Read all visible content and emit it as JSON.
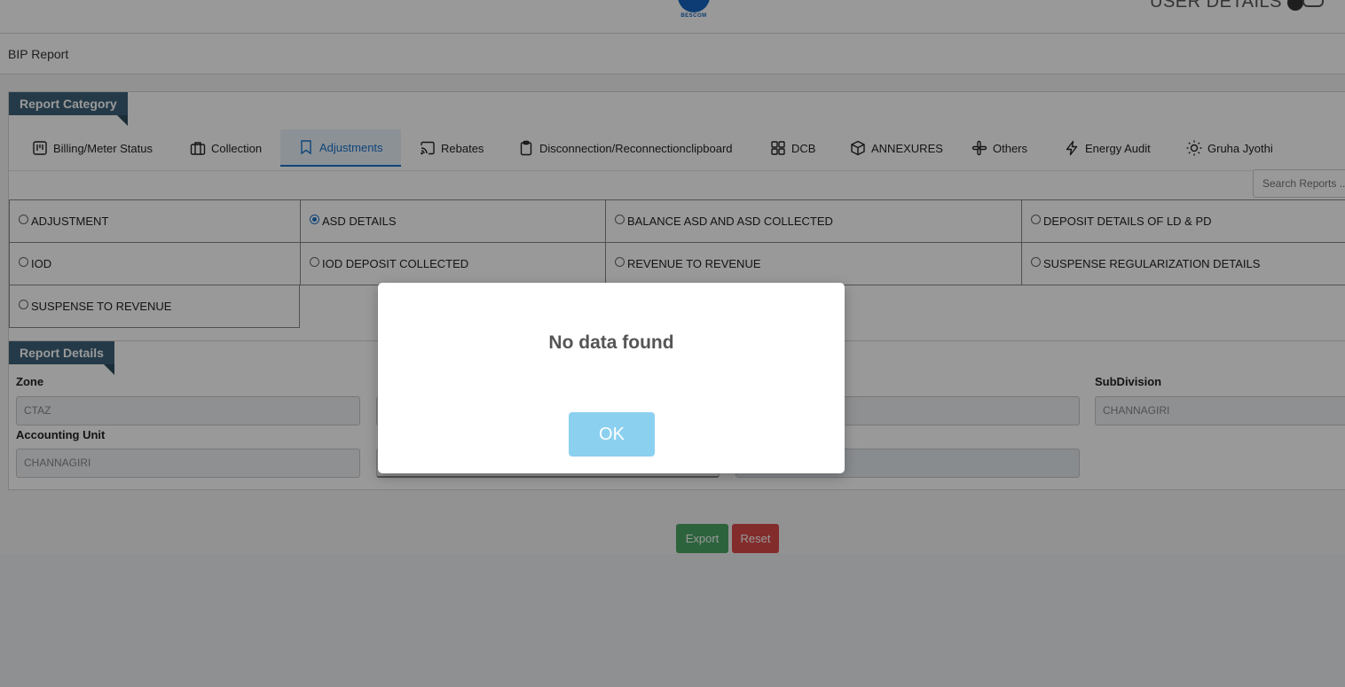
{
  "header": {
    "logo_text": "BESCOM",
    "user_details": "USER DETAILS"
  },
  "page": {
    "title": "BIP Report"
  },
  "report_category": {
    "title": "Report Category",
    "tabs": [
      {
        "label": "Billing/Meter Status",
        "icon": "kanban-icon"
      },
      {
        "label": "Collection",
        "icon": "briefcase-icon"
      },
      {
        "label": "Adjustments",
        "icon": "bookmark-icon",
        "active": true
      },
      {
        "label": "Rebates",
        "icon": "cast-icon"
      },
      {
        "label": "Disconnection/Reconnectionclipboard",
        "icon": "clipboard-icon"
      },
      {
        "label": "DCB",
        "icon": "grid-icon"
      },
      {
        "label": "ANNEXURES",
        "icon": "box-icon"
      },
      {
        "label": "Others",
        "icon": "slack-icon"
      },
      {
        "label": "Energy Audit",
        "icon": "lightning-icon"
      },
      {
        "label": "Gruha Jyothi",
        "icon": "sun-icon"
      }
    ],
    "search_placeholder": "Search Reports ...",
    "options": [
      {
        "label": "ADJUSTMENT",
        "selected": false
      },
      {
        "label": "ASD DETAILS",
        "selected": true
      },
      {
        "label": "BALANCE ASD AND ASD COLLECTED",
        "selected": false
      },
      {
        "label": "DEPOSIT DETAILS OF LD & PD",
        "selected": false
      },
      {
        "label": "IOD",
        "selected": false
      },
      {
        "label": "IOD DEPOSIT COLLECTED",
        "selected": false
      },
      {
        "label": "REVENUE TO REVENUE",
        "selected": false
      },
      {
        "label": "SUSPENSE REGULARIZATION DETAILS",
        "selected": false
      },
      {
        "label": "SUSPENSE TO REVENUE",
        "selected": false
      }
    ]
  },
  "report_details": {
    "title": "Report Details",
    "zone_label": "Zone",
    "zone_value": "CTAZ",
    "subdivision_label": "SubDivision",
    "subdivision_value": "CHANNAGIRI",
    "accounting_unit_label": "Accounting Unit",
    "accounting_unit_value": "CHANNAGIRI"
  },
  "actions": {
    "export_label": "Export",
    "reset_label": "Reset"
  },
  "modal": {
    "message": "No data found",
    "ok_label": "OK"
  },
  "colors": {
    "ribbon": "#3c6178",
    "active_tab": "#1a73c8",
    "export": "#4aa564",
    "reset": "#db4a4a",
    "ok_button": "#8cd0f0"
  }
}
